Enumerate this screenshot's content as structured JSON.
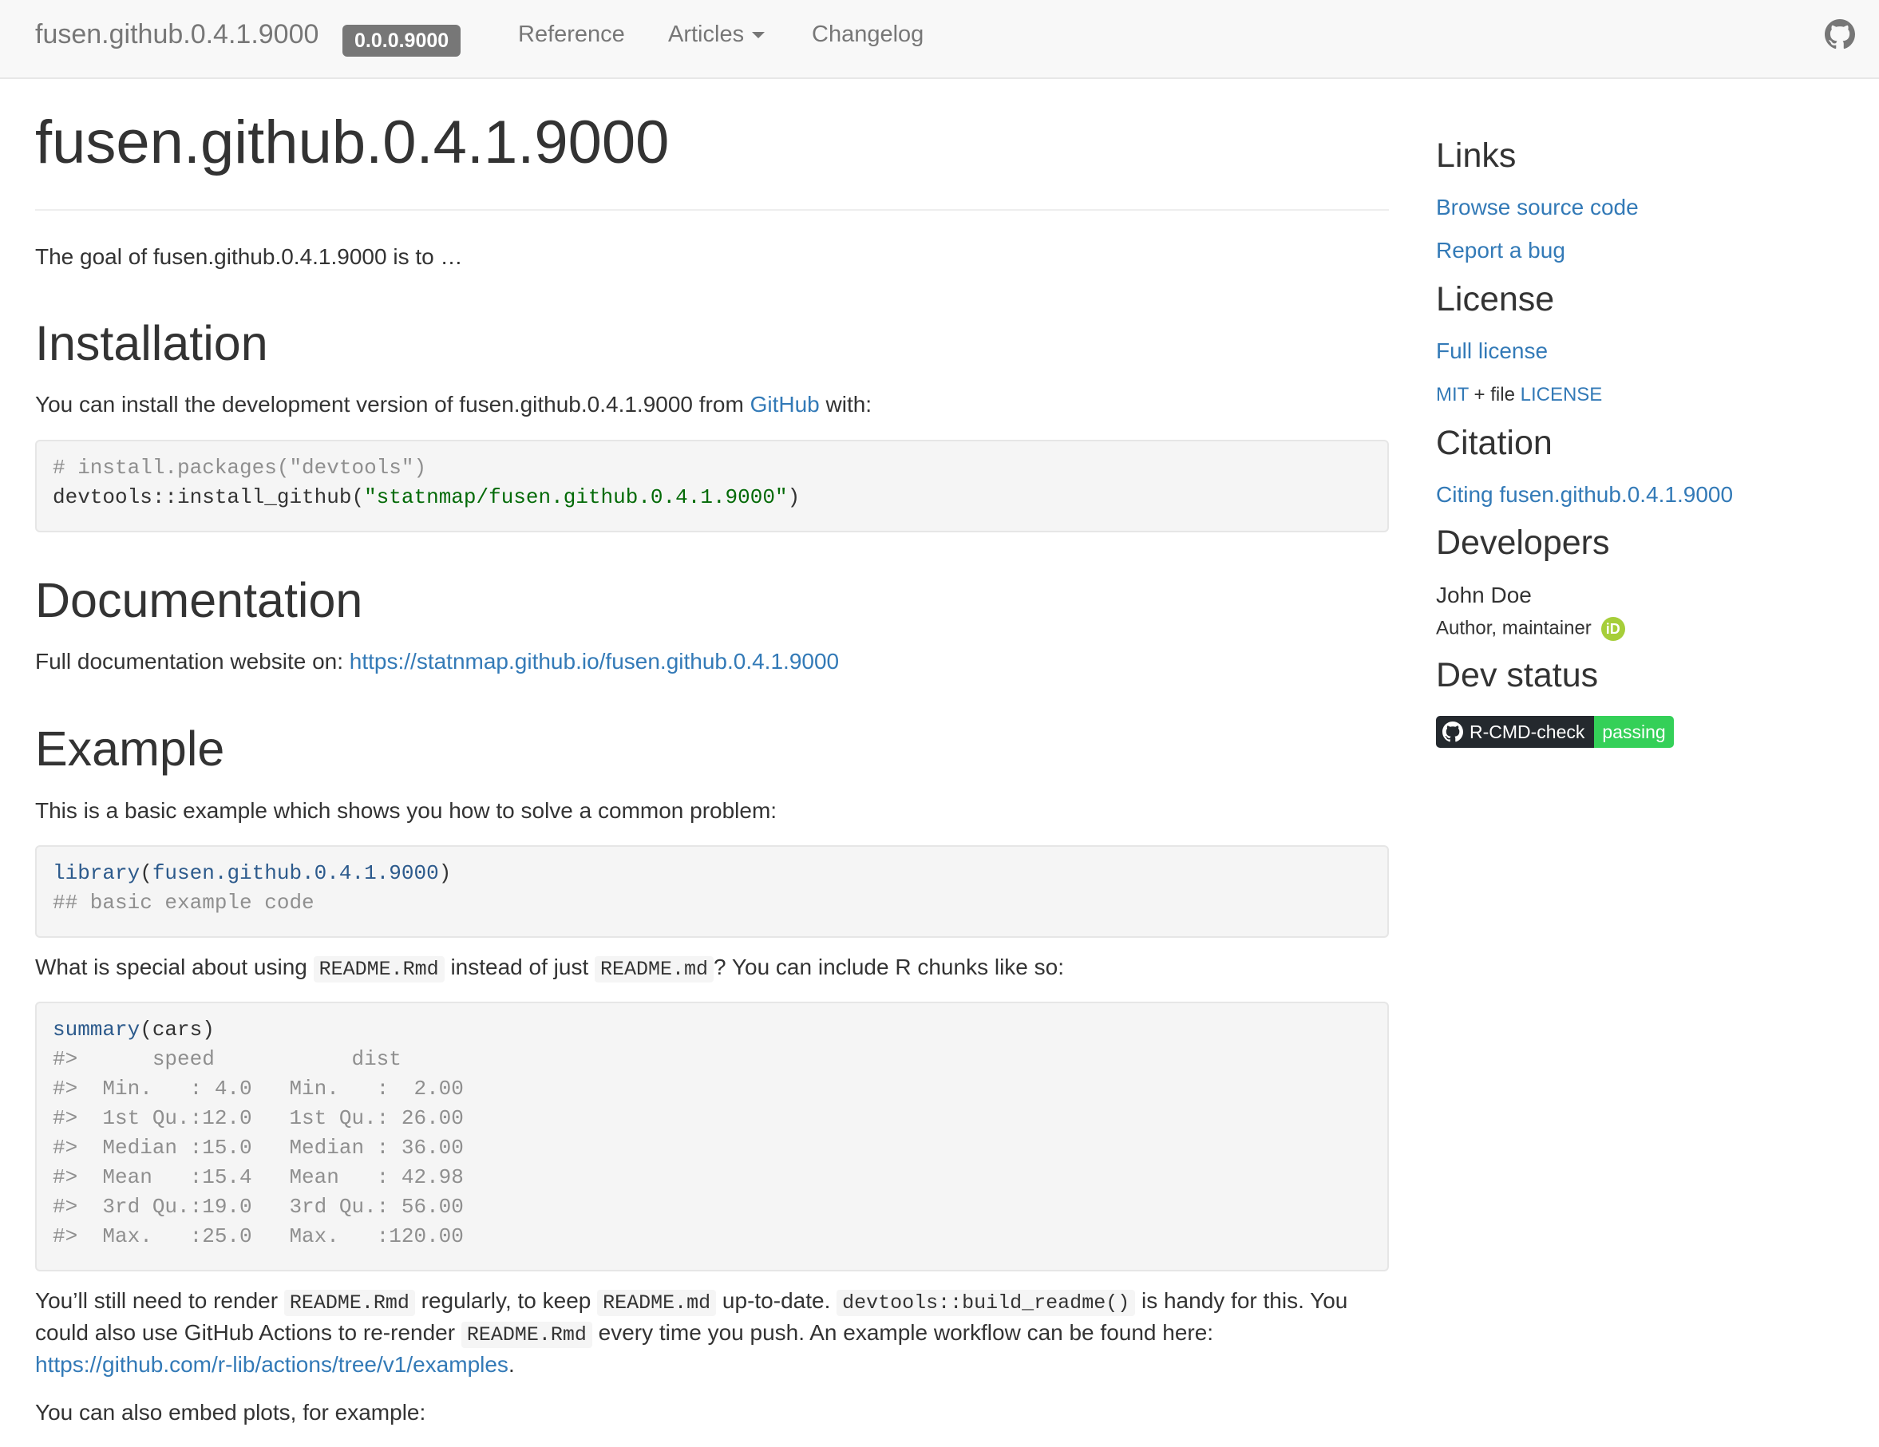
{
  "navbar": {
    "brand": "fusen.github.0.4.1.9000",
    "version": "0.0.0.9000",
    "items": {
      "reference": "Reference",
      "articles": "Articles",
      "changelog": "Changelog"
    },
    "github_icon": "github-icon"
  },
  "main": {
    "title": "fusen.github.0.4.1.9000",
    "goal": "The goal of fusen.github.0.4.1.9000 is to …",
    "installation": {
      "heading": "Installation",
      "text_before": "You can install the development version of fusen.github.0.4.1.9000 from ",
      "link": "GitHub",
      "text_after": " with:",
      "code_comment": "# install.packages(\"devtools\")",
      "code_call": "devtools::install_github(",
      "code_string": "\"statnmap/fusen.github.0.4.1.9000\"",
      "code_close": ")"
    },
    "documentation": {
      "heading": "Documentation",
      "text": "Full documentation website on: ",
      "link": "https://statnmap.github.io/fusen.github.0.4.1.9000"
    },
    "example": {
      "heading": "Example",
      "intro": "This is a basic example which shows you how to solve a common problem:",
      "code_fn": "library",
      "code_open": "(",
      "code_arg": "fusen.github.0.4.1.9000",
      "code_close": ")",
      "code_comment": "## basic example code",
      "special_1": "What is special about using ",
      "special_code1": "README.Rmd",
      "special_2": " instead of just ",
      "special_code2": "README.md",
      "special_3": "? You can include R chunks like so:",
      "summary_fn": "summary",
      "summary_args": "(cars)",
      "summary_output": [
        "#>      speed           dist       ",
        "#>  Min.   : 4.0   Min.   :  2.00  ",
        "#>  1st Qu.:12.0   1st Qu.: 26.00  ",
        "#>  Median :15.0   Median : 36.00  ",
        "#>  Mean   :15.4   Mean   : 42.98  ",
        "#>  3rd Qu.:19.0   3rd Qu.: 56.00  ",
        "#>  Max.   :25.0   Max.   :120.00  "
      ],
      "render_1": "You’ll still need to render ",
      "render_code1": "README.Rmd",
      "render_2": " regularly, to keep ",
      "render_code2": "README.md",
      "render_3": " up-to-date. ",
      "render_code3": "devtools::build_readme()",
      "render_4": " is handy for this. You",
      "render_5": "could also use GitHub Actions to re-render ",
      "render_code4": "README.Rmd",
      "render_6": " every time you push. An example workflow can be found here:",
      "render_link": "https://github.com/r-lib/actions/tree/v1/examples",
      "render_period": ".",
      "plots": "You can also embed plots, for example:"
    }
  },
  "sidebar": {
    "links_heading": "Links",
    "browse_source": "Browse source code",
    "report_bug": "Report a bug",
    "license_heading": "License",
    "full_license": "Full license",
    "mit": "MIT",
    "plus_file": " + file ",
    "license_file": "LICENSE",
    "citation_heading": "Citation",
    "citing": "Citing fusen.github.0.4.1.9000",
    "developers_heading": "Developers",
    "dev_name": "John Doe",
    "dev_role": "Author, maintainer",
    "orcid_icon": "orcid-icon",
    "orcid_text": "iD",
    "dev_status_heading": "Dev status",
    "badge_label": "R-CMD-check",
    "badge_status": "passing"
  }
}
